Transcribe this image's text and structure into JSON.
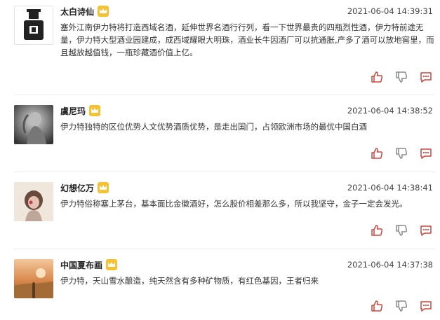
{
  "comments": [
    {
      "username": "太白诗仙",
      "time": "2021-06-04 14:39:31",
      "text": "塞外江南伊力特将打造西域名酒，延伸世界名酒行行列，看一下世界最贵的四瓶烈性酒，伊力特前途无量，伊力特大型酒业园建成，成西域耀眼大明珠，酒业长牛因酒厂可以抗通胀,产多了酒可以放地窖里，而且越放越值钱，一瓶珍藏酒价值上亿。",
      "avatar_icon": "sign-figure-avatar"
    },
    {
      "username": "虞尼玛",
      "time": "2021-06-04 14:38:52",
      "text": "伊力特独特的区位优势人文优势酒质优势，是走出国门，占领欧洲市场的最优中国白酒",
      "avatar_icon": "woman-photo-avatar"
    },
    {
      "username": "幻想亿万",
      "time": "2021-06-04 14:38:41",
      "text": "伊力特俗称塞上茅台，基本面比金徽酒好，怎么股价相差那么多，所以我坚守，金子一定会发光。",
      "avatar_icon": "girl-photo-avatar"
    },
    {
      "username": "中国夏布画",
      "time": "2021-06-04 14:37:38",
      "text": "伊力特，天山雪水酿造，纯天然含有多种矿物质，有红色基因，王者归来",
      "avatar_icon": "sunset-field-avatar"
    }
  ],
  "icons": {
    "vip": "crown-icon",
    "like": "thumbs-up-icon",
    "dislike": "thumbs-down-icon",
    "reply": "comment-icon"
  },
  "colors": {
    "action_red": "#d0453c",
    "action_gray": "#8a8a8a",
    "vip_gold": "#f4c232"
  }
}
